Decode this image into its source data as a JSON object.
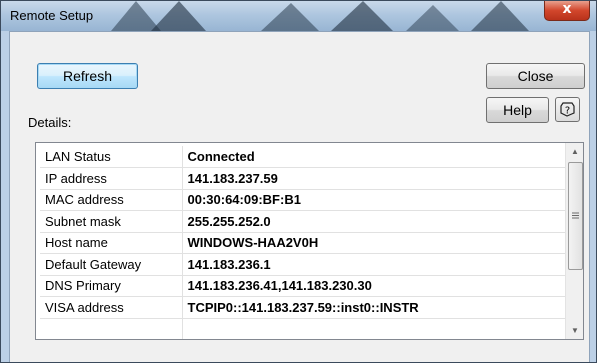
{
  "window": {
    "title": "Remote Setup",
    "close_glyph": "x"
  },
  "buttons": {
    "refresh": "Refresh",
    "close": "Close",
    "help": "Help",
    "context_help_icon": "question-mark-icon"
  },
  "details": {
    "label": "Details:",
    "rows": [
      {
        "key": "LAN Status",
        "value": "Connected"
      },
      {
        "key": "IP address",
        "value": "141.183.237.59"
      },
      {
        "key": "MAC address",
        "value": "00:30:64:09:BF:B1"
      },
      {
        "key": "Subnet mask",
        "value": "255.255.252.0"
      },
      {
        "key": "Host name",
        "value": "WINDOWS-HAA2V0H"
      },
      {
        "key": "Default Gateway",
        "value": "141.183.236.1"
      },
      {
        "key": "DNS Primary",
        "value": "141.183.236.41,141.183.230.30"
      },
      {
        "key": "VISA address",
        "value": "TCPIP0::141.183.237.59::inst0::INSTR"
      }
    ]
  },
  "colors": {
    "titlebar": "#aec6df",
    "close_button": "#d2462c",
    "dialog_bg": "#f0f0f0"
  }
}
